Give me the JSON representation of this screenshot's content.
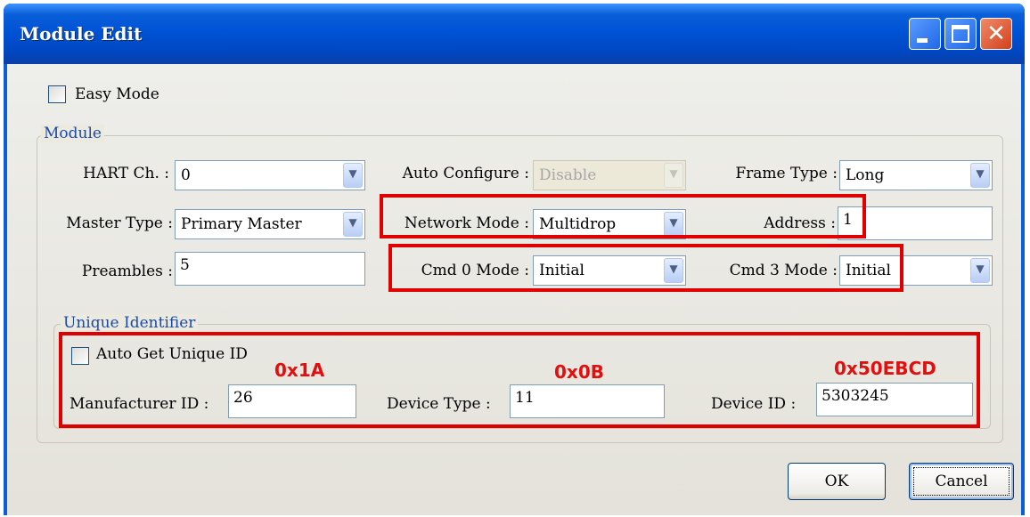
{
  "window": {
    "title": "Module Edit",
    "controls": {
      "minimize": "minimize",
      "maximize": "maximize",
      "close": "close"
    }
  },
  "easy_mode": {
    "label": "Easy Mode",
    "checked": false
  },
  "module": {
    "legend": "Module",
    "hart_ch": {
      "label": "HART Ch. :",
      "value": "0"
    },
    "auto_configure": {
      "label": "Auto Configure :",
      "value": "Disable",
      "disabled": true
    },
    "frame_type": {
      "label": "Frame Type :",
      "value": "Long"
    },
    "master_type": {
      "label": "Master Type :",
      "value": "Primary Master"
    },
    "network_mode": {
      "label": "Network Mode :",
      "value": "Multidrop"
    },
    "address": {
      "label": "Address :",
      "value": "1"
    },
    "preambles": {
      "label": "Preambles :",
      "value": "5"
    },
    "cmd0_mode": {
      "label": "Cmd 0 Mode :",
      "value": "Initial"
    },
    "cmd3_mode": {
      "label": "Cmd 3 Mode :",
      "value": "Initial"
    }
  },
  "unique_identifier": {
    "legend": "Unique Identifier",
    "auto_get": {
      "label": "Auto Get Unique ID",
      "checked": false
    },
    "manufacturer_id": {
      "label": "Manufacturer ID :",
      "value": "26",
      "hex_annotation": "0x1A"
    },
    "device_type": {
      "label": "Device Type :",
      "value": "11",
      "hex_annotation": "0x0B"
    },
    "device_id": {
      "label": "Device ID :",
      "value": "5303245",
      "hex_annotation": "0x50EBCD"
    }
  },
  "buttons": {
    "ok": "OK",
    "cancel": "Cancel"
  },
  "colors": {
    "title_bar": "#0a5fd8",
    "client_bg": "#ece9d8",
    "annotation_red": "#e00000",
    "legend_blue": "#1a4aa8"
  },
  "icons": {
    "minimize": "minimize-icon",
    "maximize": "maximize-icon",
    "close": "close-icon",
    "dropdown": "chevron-down-icon"
  }
}
